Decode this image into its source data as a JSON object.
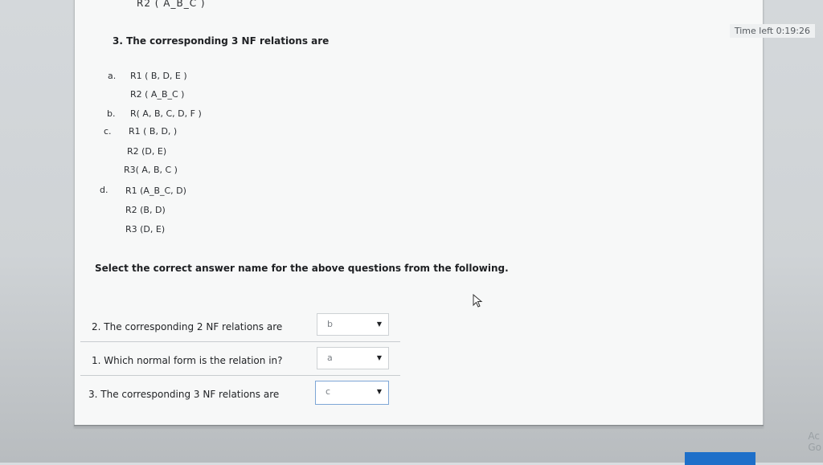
{
  "header": {
    "clipped_text": "R2 ( A_B_C )",
    "timer": "Time left 0:19:26"
  },
  "question": {
    "title": "3. The corresponding 3 NF relations are",
    "options": [
      {
        "letter": "a.",
        "lines": [
          "R1 ( B, D, E )",
          "R2 ( A_B_C )"
        ]
      },
      {
        "letter": "b.",
        "lines": [
          "R( A, B, C, D, F )"
        ]
      },
      {
        "letter": "c.",
        "lines": [
          "R1 ( B, D, )",
          "R2 (D, E)",
          "R3( A, B, C )"
        ]
      },
      {
        "letter": "d.",
        "lines": [
          "R1 (A_B_C, D)",
          "R2 (B, D)",
          "R3 (D, E)"
        ]
      }
    ]
  },
  "instruction": "Select the correct answer name for the above questions from the following.",
  "matching": [
    {
      "label": "2. The corresponding 2 NF relations are",
      "value": "b",
      "active": false
    },
    {
      "label": "1. Which normal form is the relation in?",
      "value": "a",
      "active": false
    },
    {
      "label": "3. The corresponding 3 NF relations are",
      "value": "c",
      "active": true
    }
  ],
  "corner": {
    "line1": "Ac",
    "line2": "Go"
  },
  "colors": {
    "accent": "#1e6fc9",
    "panel": "#f7f8f8"
  },
  "icons": {
    "cursor": "mouse-cursor-icon",
    "dropdown": "chevron-down-icon"
  }
}
